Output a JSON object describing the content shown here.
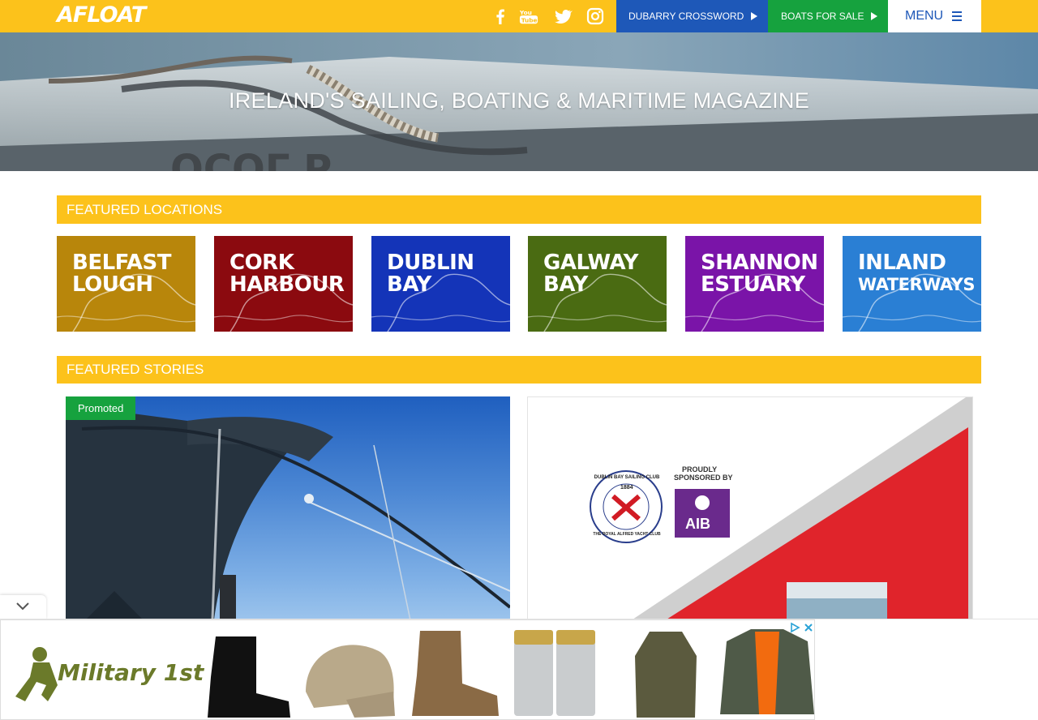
{
  "header": {
    "logo_text": "AFLOAT",
    "social": [
      "facebook-icon",
      "youtube-icon",
      "twitter-icon",
      "instagram-icon"
    ],
    "crossword_label": "DUBARRY CROSSWORD",
    "boats_label": "BOATS FOR SALE",
    "menu_label": "MENU"
  },
  "hero": {
    "title": "IRELAND'S SAILING, BOATING & MARITIME MAGAZINE"
  },
  "locations": {
    "heading": "FEATURED LOCATIONS",
    "tiles": [
      {
        "line1": "BELFAST",
        "line2": "LOUGH",
        "color": "#b8860b"
      },
      {
        "line1": "CORK",
        "line2": "HARBOUR",
        "color": "#8b0a0f"
      },
      {
        "line1": "DUBLIN",
        "line2": "BAY",
        "color": "#1434b8"
      },
      {
        "line1": "GALWAY",
        "line2": "BAY",
        "color": "#4a6b12"
      },
      {
        "line1": "SHANNON",
        "line2": "ESTUARY",
        "color": "#7a14a8"
      },
      {
        "line1": "INLAND",
        "line2": "WATERWAYS",
        "color": "#2a7fd4"
      }
    ]
  },
  "stories": {
    "heading": "FEATURED STORIES",
    "promoted_label": "Promoted",
    "right_card": {
      "club_year": "1884",
      "club_name": "DUBLIN BAY SAILING CLUB",
      "club_sub": "THE ROYAL ALFRED YACHT CLUB",
      "sponsor_text_1": "PROUDLY",
      "sponsor_text_2": "SPONSORED BY",
      "sponsor_name": "AIB"
    }
  },
  "ad": {
    "brand": "Military 1st",
    "products": [
      "boots",
      "cap",
      "desert-boots",
      "shotgun-shells",
      "parka",
      "bomber-jacket"
    ]
  },
  "colors": {
    "brand_yellow": "#fcc21b",
    "crossword_blue": "#1e58b8",
    "boats_green": "#16a23e"
  }
}
